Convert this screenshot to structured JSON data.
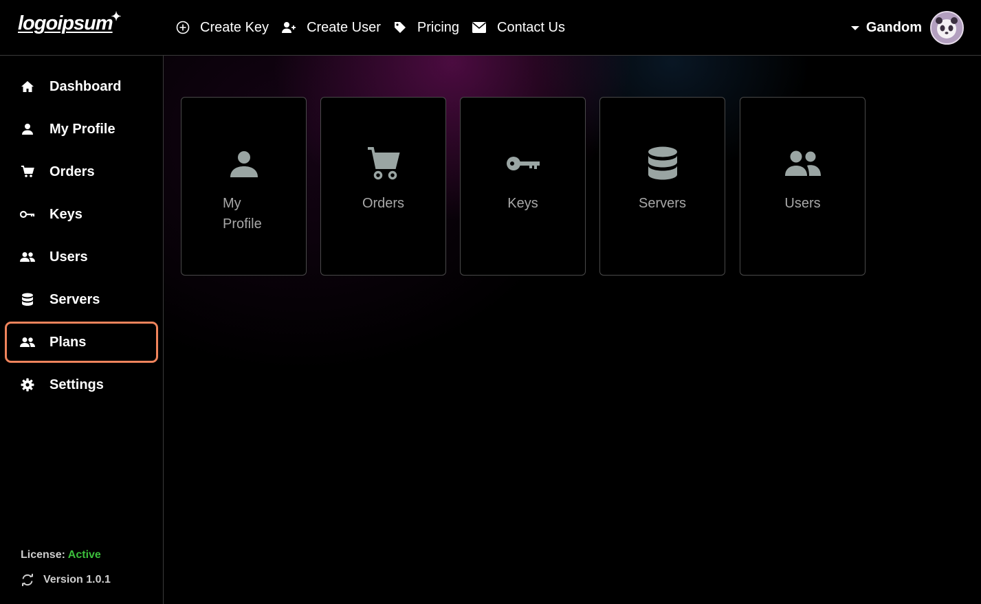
{
  "header": {
    "logo_text": "logoipsum",
    "nav": [
      {
        "label": "Create Key",
        "icon": "plus-circle-icon"
      },
      {
        "label": "Create User",
        "icon": "user-plus-icon"
      },
      {
        "label": "Pricing",
        "icon": "tag-icon"
      },
      {
        "label": "Contact Us",
        "icon": "envelope-icon"
      }
    ],
    "username": "Gandom",
    "avatar_icon": "panda-avatar-icon"
  },
  "sidebar": {
    "items": [
      {
        "label": "Dashboard",
        "icon": "home-icon",
        "active": false
      },
      {
        "label": "My Profile",
        "icon": "user-icon",
        "active": false
      },
      {
        "label": "Orders",
        "icon": "cart-icon",
        "active": false
      },
      {
        "label": "Keys",
        "icon": "key-icon",
        "active": false
      },
      {
        "label": "Users",
        "icon": "users-icon",
        "active": false
      },
      {
        "label": "Servers",
        "icon": "database-icon",
        "active": false
      },
      {
        "label": "Plans",
        "icon": "users-icon",
        "active": true
      },
      {
        "label": "Settings",
        "icon": "gear-icon",
        "active": false
      }
    ],
    "license_label": "License:",
    "license_status": "Active",
    "version_text": "Version 1.0.1"
  },
  "cards": [
    {
      "line1": "My",
      "line2": "Profile",
      "icon": "user-icon"
    },
    {
      "label": "Orders",
      "icon": "cart-icon"
    },
    {
      "label": "Keys",
      "icon": "key-icon"
    },
    {
      "label": "Servers",
      "icon": "database-icon"
    },
    {
      "label": "Users",
      "icon": "users-icon"
    }
  ],
  "colors": {
    "active_border": "#f0845c",
    "license_active": "#3cbf3c",
    "card_icon": "#9aa5a3",
    "card_label": "#a8a8a8"
  }
}
